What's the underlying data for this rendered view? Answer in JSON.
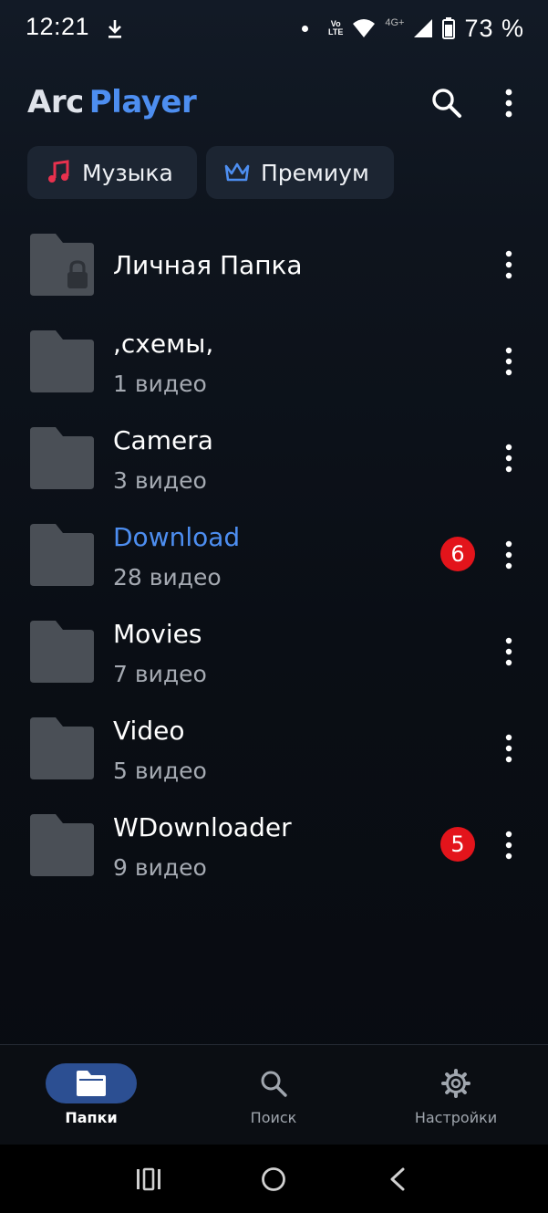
{
  "status_bar": {
    "time": "12:21",
    "volte_top": "Vo",
    "volte_bottom": "LTE",
    "network": "4G+",
    "battery": "73 %"
  },
  "header": {
    "logo_arc": "Arc",
    "logo_player": "Player",
    "search_icon": "search-icon",
    "more_icon": "more-vert-icon"
  },
  "chips": {
    "music": {
      "label": "Музыка",
      "icon": "music-note-icon",
      "color": "#e8314e"
    },
    "premium": {
      "label": "Премиум",
      "icon": "crown-icon",
      "color": "#4d8ef0"
    }
  },
  "folders": [
    {
      "name": "Личная Папка",
      "count": "",
      "badge": "",
      "locked": true
    },
    {
      "name": ",схемы,",
      "count": "1 видео",
      "badge": ""
    },
    {
      "name": "Camera",
      "count": "3 видео",
      "badge": ""
    },
    {
      "name": "Download",
      "count": "28 видео",
      "badge": "6",
      "highlight": true
    },
    {
      "name": "Movies",
      "count": "7 видео",
      "badge": ""
    },
    {
      "name": "Video",
      "count": "5 видео",
      "badge": ""
    },
    {
      "name": "WDownloader",
      "count": "9 видео",
      "badge": "5"
    }
  ],
  "bottom_nav": {
    "folders": {
      "label": "Папки",
      "icon": "folder-icon",
      "active": true
    },
    "search": {
      "label": "Поиск",
      "icon": "search-icon"
    },
    "settings": {
      "label": "Настройки",
      "icon": "gear-icon"
    }
  },
  "colors": {
    "accent": "#4d8ef0",
    "badge": "#e3141b",
    "folder": "#4a4f56",
    "nav_pill": "#2c4f92"
  }
}
